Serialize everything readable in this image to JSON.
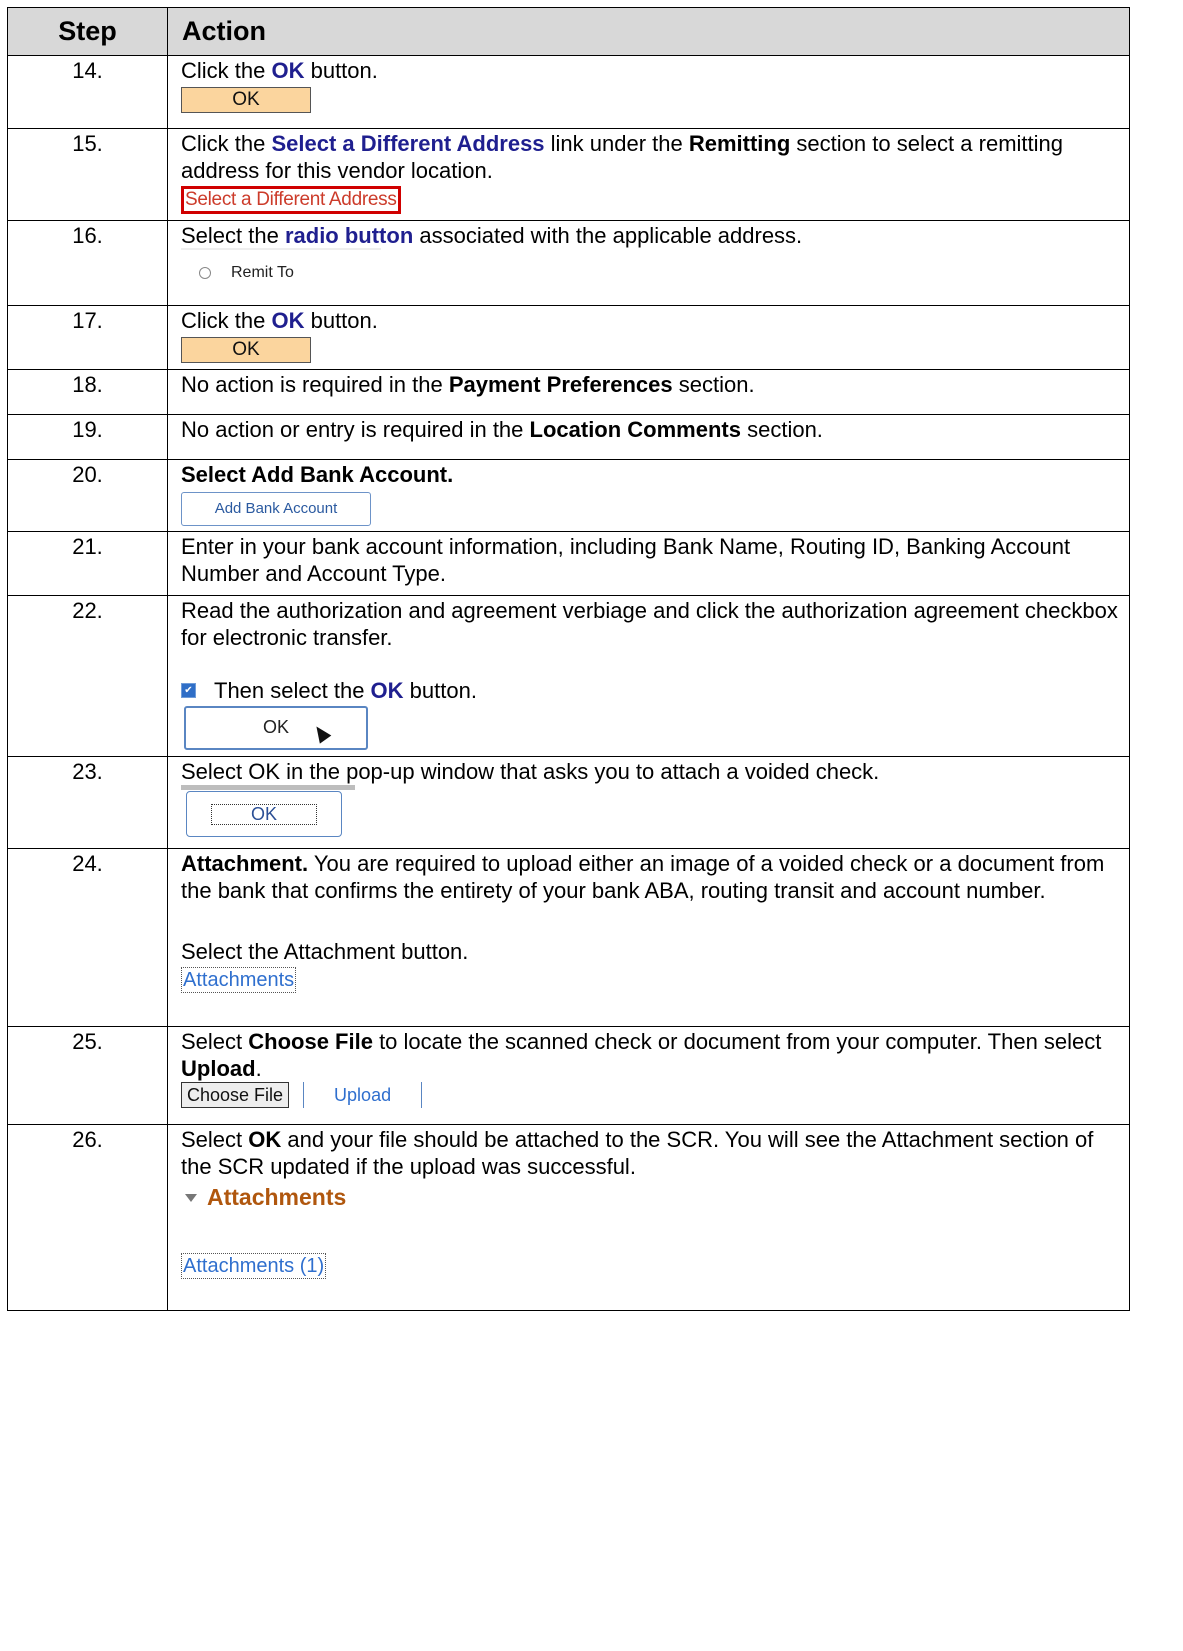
{
  "headers": {
    "step": "Step",
    "action": "Action"
  },
  "rows": {
    "s14": {
      "num": "14.",
      "t1": "Click the ",
      "b1": "OK",
      "t2": " button.",
      "btn": "OK"
    },
    "s15": {
      "num": "15.",
      "t1": "Click the ",
      "b1": "Select a Different Address",
      "t2": " link under the ",
      "b2": "Remitting",
      "t3": " section to select a remitting address for this vendor location.",
      "link": "Select a Different Address"
    },
    "s16": {
      "num": "16.",
      "t1": "Select the ",
      "b1": "radio button",
      "t2": " associated with the applicable address.",
      "radio_label": "Remit To"
    },
    "s17": {
      "num": "17.",
      "t1": "Click the ",
      "b1": "OK",
      "t2": " button.",
      "btn": "OK"
    },
    "s18": {
      "num": "18.",
      "t1": "No action is required in the ",
      "b1": "Payment Preferences",
      "t2": " section."
    },
    "s19": {
      "num": "19.",
      "t1": "No action or entry is required in the ",
      "b1": "Location Comments",
      "t2": " section."
    },
    "s20": {
      "num": "20.",
      "b1": "Select Add Bank Account.",
      "btn": "Add Bank Account"
    },
    "s21": {
      "num": "21.",
      "t1": "Enter in your bank account information, including Bank Name, Routing ID, Banking Account Number and Account Type."
    },
    "s22": {
      "num": "22.",
      "t1": "Read the authorization and agreement verbiage and click the authorization agreement checkbox for electronic transfer.",
      "t2": "Then select the ",
      "b1": "OK",
      "t3": " button.",
      "btn": "OK"
    },
    "s23": {
      "num": "23.",
      "t1": "Select OK in the pop-up window that asks you to attach a voided check.",
      "btn": "OK"
    },
    "s24": {
      "num": "24.",
      "b1": "Attachment.",
      "t1": " You are required to upload either an image of a voided check or a document from the bank that confirms the entirety of your bank ABA, routing transit and account number.",
      "t2": "Select the Attachment button.",
      "link": "Attachments"
    },
    "s25": {
      "num": "25.",
      "t1": "Select ",
      "b1": "Choose File",
      "t2": " to locate the scanned check or document from your computer.  Then select ",
      "b2": "Upload",
      "t3": ".",
      "choose": "Choose File",
      "upload": "Upload"
    },
    "s26": {
      "num": "26.",
      "t1": "Select ",
      "b1": "OK",
      "t2": " and your file should be attached to the SCR.  You will see the Attachment section of the SCR updated if the upload was successful.",
      "section": "Attachments",
      "link": "Attachments (1)"
    }
  }
}
